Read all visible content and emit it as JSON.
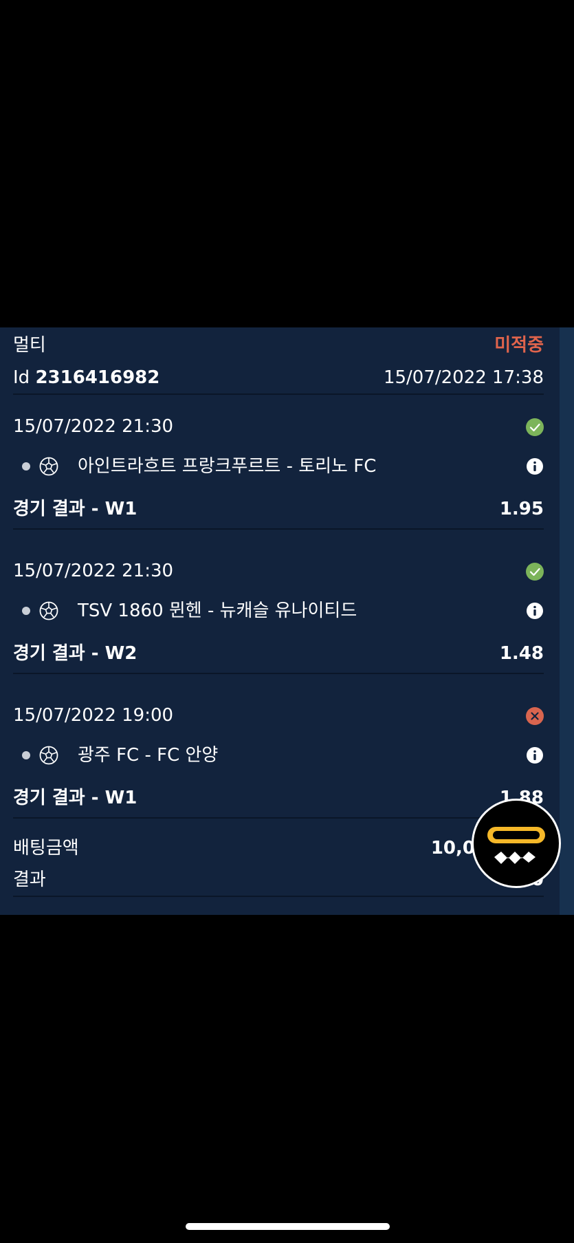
{
  "bet": {
    "type_label": "멀티",
    "status": "미적중",
    "id_prefix": "Id",
    "id_value": "2316416982",
    "placed_at": "15/07/2022 17:38",
    "status_color": "#e0644c"
  },
  "events": [
    {
      "datetime": "15/07/2022 21:30",
      "result_icon": "check-circle-icon",
      "result_color": "#7cb45a",
      "sport_icon": "soccer-ball-icon",
      "match": "아인트라흐트 프랑크푸르트 - 토리노 FC",
      "market": "경기 결과 - W1",
      "odds": "1.95"
    },
    {
      "datetime": "15/07/2022 21:30",
      "result_icon": "check-circle-icon",
      "result_color": "#7cb45a",
      "sport_icon": "soccer-ball-icon",
      "match": "TSV 1860 뮌헨 - 뉴캐슬 유나이티드",
      "market": "경기 결과 - W2",
      "odds": "1.48"
    },
    {
      "datetime": "15/07/2022 19:00",
      "result_icon": "cross-circle-icon",
      "result_color": "#d9654f",
      "sport_icon": "soccer-ball-icon",
      "match": "광주 FC - FC 안양",
      "market": "경기 결과 - W1",
      "odds": "1.88"
    }
  ],
  "summary": {
    "stake_label": "배팅금액",
    "stake_value": "10,0",
    "result_label": "결과",
    "result_value": "0"
  },
  "fab": {
    "icon": "hotdog-logo-icon",
    "bun_color": "#f5b829"
  }
}
